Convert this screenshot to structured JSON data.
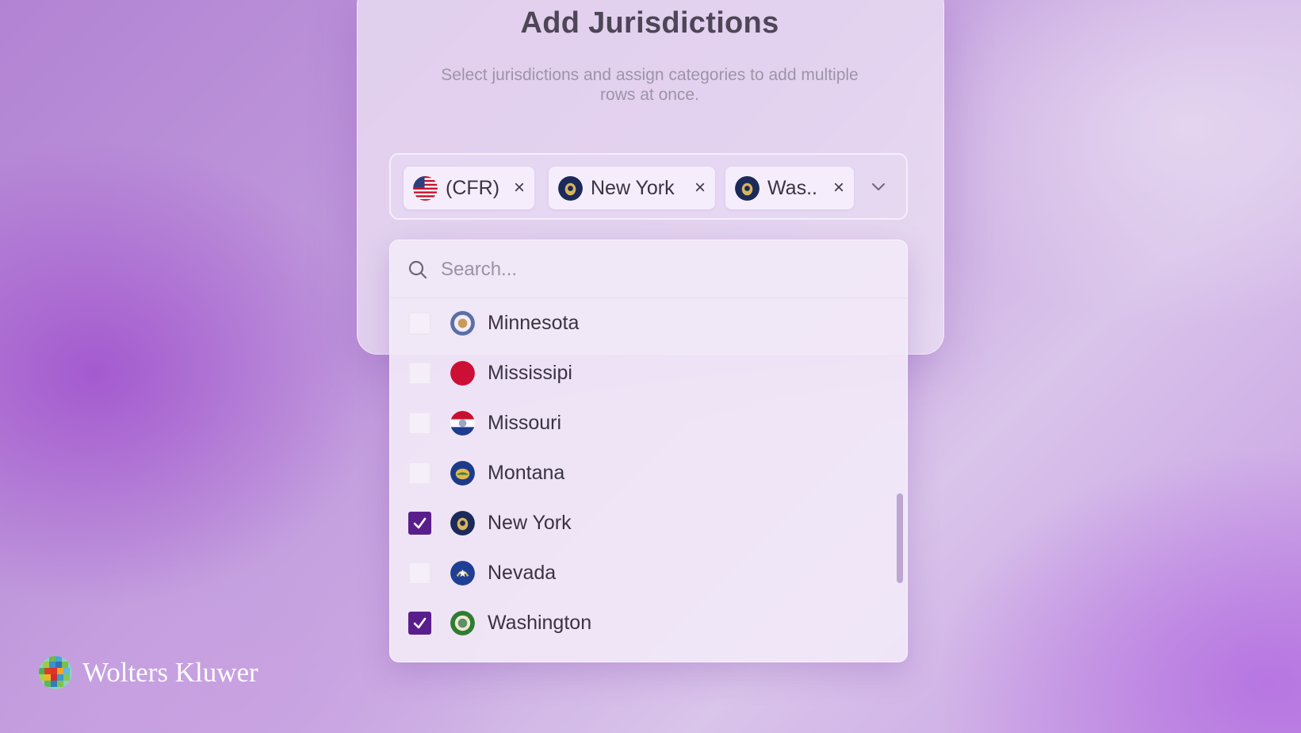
{
  "dialog": {
    "title": "Add Jurisdictions",
    "subtitle": "Select jurisdictions and assign categories to add multiple rows at once."
  },
  "selected_chips": [
    {
      "label": "(CFR)",
      "flag": "us-flag-icon",
      "remove": "×"
    },
    {
      "label": "New York",
      "flag": "new-york-seal-icon",
      "remove": "×"
    },
    {
      "label": "Was..",
      "flag": "washington-seal-icon",
      "remove": "×"
    }
  ],
  "search": {
    "placeholder": "Search...",
    "value": ""
  },
  "options": [
    {
      "label": "Minnesota",
      "checked": false,
      "flag": "minnesota-flag-icon"
    },
    {
      "label": "Mississipi",
      "checked": false,
      "flag": "mississippi-flag-icon"
    },
    {
      "label": "Missouri",
      "checked": false,
      "flag": "missouri-flag-icon"
    },
    {
      "label": "Montana",
      "checked": false,
      "flag": "montana-flag-icon"
    },
    {
      "label": "New York",
      "checked": true,
      "flag": "new-york-flag-icon"
    },
    {
      "label": "Nevada",
      "checked": false,
      "flag": "nevada-flag-icon"
    },
    {
      "label": "Washington",
      "checked": true,
      "flag": "washington-flag-icon"
    }
  ],
  "brand": {
    "name": "Wolters Kluwer"
  },
  "colors": {
    "accent": "#5a1e8c",
    "text": "#3a3342",
    "title": "#4e4657"
  }
}
